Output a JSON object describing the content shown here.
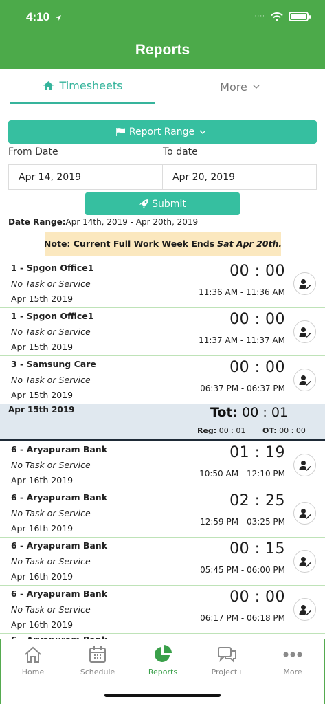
{
  "status_bar": {
    "time": "4:10",
    "signal": "····"
  },
  "header": {
    "title": "Reports"
  },
  "tabs": {
    "timesheets": "Timesheets",
    "more": "More"
  },
  "filters": {
    "report_range_label": "Report Range",
    "from_label": "From Date",
    "to_label": "To date",
    "from_value": "Apr 14, 2019",
    "to_value": "Apr 20, 2019",
    "submit_label": "Submit",
    "date_range_label": "Date Range:",
    "date_range_value": "Apr 14th, 2019 - Apr 20th, 2019"
  },
  "note": {
    "text": "Note: Current Full Work Week Ends",
    "emphasis": "Sat Apr 20th."
  },
  "entries": [
    {
      "name": "1 - Spgon Office1",
      "task": "No Task or Service",
      "date": "Apr 15th 2019",
      "duration": "00 : 00",
      "range": "11:36 AM - 11:36 AM"
    },
    {
      "name": "1 - Spgon Office1",
      "task": "No Task or Service",
      "date": "Apr 15th 2019",
      "duration": "00 : 00",
      "range": "11:37 AM - 11:37 AM"
    },
    {
      "name": "3 - Samsung Care",
      "task": "No Task or Service",
      "date": "Apr 15th 2019",
      "duration": "00 : 00",
      "range": "06:37 PM - 06:37 PM"
    },
    {
      "name": "6 - Aryapuram Bank",
      "task": "No Task or Service",
      "date": "Apr 16th 2019",
      "duration": "01 : 19",
      "range": "10:50 AM - 12:10 PM"
    },
    {
      "name": "6 - Aryapuram Bank",
      "task": "No Task or Service",
      "date": "Apr 16th 2019",
      "duration": "02 : 25",
      "range": "12:59 PM - 03:25 PM"
    },
    {
      "name": "6 - Aryapuram Bank",
      "task": "No Task or Service",
      "date": "Apr 16th 2019",
      "duration": "00 : 15",
      "range": "05:45 PM - 06:00 PM"
    },
    {
      "name": "6 - Aryapuram Bank",
      "task": "No Task or Service",
      "date": "Apr 16th 2019",
      "duration": "00 : 00",
      "range": "06:17 PM - 06:18 PM"
    }
  ],
  "summary": {
    "date": "Apr 15th 2019",
    "tot_label": "Tot:",
    "tot_value": "00 : 01",
    "reg_label": "Reg:",
    "reg_value": "00 : 01",
    "ot_label": "OT:",
    "ot_value": "00 : 00"
  },
  "peek_entry": {
    "name": "6 - Aryapuram Bank"
  },
  "bottom_tabs": [
    {
      "label": "Home"
    },
    {
      "label": "Schedule"
    },
    {
      "label": "Reports",
      "active": true
    },
    {
      "label": "Project+"
    },
    {
      "label": "More"
    }
  ],
  "colors": {
    "header_green": "#4caa4a",
    "teal": "#36bfa0",
    "active_green": "#3aa04a",
    "note_bg": "#fbe8bf"
  }
}
